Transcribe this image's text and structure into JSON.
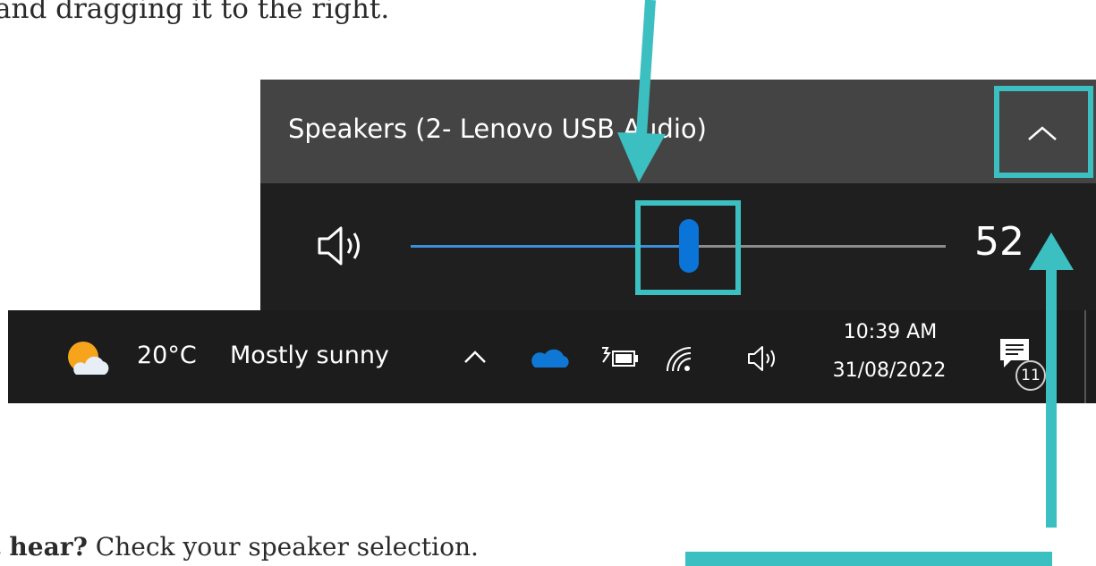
{
  "article": {
    "top_line": "and dragging it to the right.",
    "bottom_bold": "’t hear?",
    "bottom_rest": " Check your speaker selection."
  },
  "volume_flyout": {
    "device_name": "Speakers (2- Lenovo USB Audio)",
    "expand_icon": "chevron-up-icon",
    "speaker_icon": "speaker-icon",
    "volume_level": 52,
    "volume_label": "52"
  },
  "taskbar": {
    "weather_icon": "sun-cloud-icon",
    "weather_temp": "20°C",
    "weather_condition": "Mostly sunny",
    "tray_icons": [
      "chevron-up-icon",
      "onedrive-cloud-icon",
      "battery-charging-icon",
      "wifi-icon",
      "speaker-icon"
    ],
    "time": "10:39 AM",
    "date": "31/08/2022",
    "notification_count": "11"
  },
  "annotations": {
    "color": "#3cbfc1"
  },
  "colors": {
    "flyout_header": "#444444",
    "flyout_body": "#1f1f1f",
    "slider_fill": "#3b8fd9",
    "slider_thumb": "#0a74d9",
    "taskbar": "#1c1c1c"
  }
}
